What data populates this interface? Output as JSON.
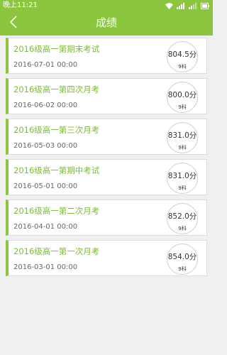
{
  "status": {
    "time": "晚上11:21"
  },
  "header": {
    "title": "成绩"
  },
  "exams": [
    {
      "name": "2016级高一第期末考试",
      "date": "2016-07-01 00:00",
      "score": "804.5分",
      "subjects": "9科"
    },
    {
      "name": "2016级高一第四次月考",
      "date": "2016-06-02 00:00",
      "score": "800.0分",
      "subjects": "9科"
    },
    {
      "name": "2016级高一第三次月考",
      "date": "2016-05-03 00:00",
      "score": "831.0分",
      "subjects": "9科"
    },
    {
      "name": "2016级高一第期中考试",
      "date": "2016-05-01 00:00",
      "score": "831.0分",
      "subjects": "9科"
    },
    {
      "name": "2016级高一第二次月考",
      "date": "2016-04-01 00:00",
      "score": "852.0分",
      "subjects": "9科"
    },
    {
      "name": "2016级高一第一次月考",
      "date": "2016-03-01 00:00",
      "score": "854.0分",
      "subjects": "9科"
    }
  ],
  "colors": {
    "accent": "#8cc63e",
    "accent_text": "#7dbb3a"
  },
  "icons": {
    "back": "chevron-left-icon"
  }
}
